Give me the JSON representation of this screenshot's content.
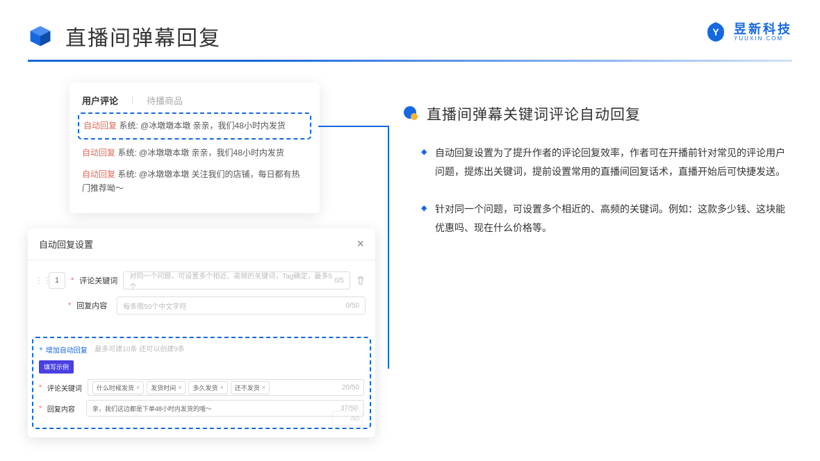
{
  "header": {
    "title": "直播间弹幕回复"
  },
  "logo": {
    "name": "昱新科技",
    "domain": "YUUXIN.COM"
  },
  "panel1": {
    "tab_active": "用户评论",
    "tab_inactive": "待播商品",
    "c1_label": "自动回复",
    "c1_sys": "系统: ",
    "c1_text": "@冰墩墩本墩 亲亲，我们48小时内发货",
    "c2_label": "自动回复",
    "c2_sys": "系统: ",
    "c2_text": "@冰墩墩本墩 亲亲，我们48小时内发货",
    "c3_label": "自动回复",
    "c3_sys": "系统: ",
    "c3_text": "@冰墩墩本墩 关注我们的店铺，每日都有热门推荐呦～"
  },
  "panel2": {
    "title": "自动回复设置",
    "index": "1",
    "keyword_label": "评论关键词",
    "keyword_placeholder": "对同一个问题，可设置多个相近、高频的关键词，Tag确定，最多5个",
    "keyword_count": "0/5",
    "content_label": "回复内容",
    "content_placeholder": "每条限50个中文字符",
    "content_count": "0/50",
    "add_label": "增加自动回复",
    "add_hint": "最多可建10条 还可以创建9条",
    "example_badge": "填写示例",
    "ex_kw_label": "评论关键词",
    "ex_tags": [
      "什么时候发货",
      "发货时间",
      "多久发货",
      "还不发货"
    ],
    "ex_kw_count": "20/50",
    "ex_content_label": "回复内容",
    "ex_content_text": "亲，我们这边都是下单48小时内发货的哦～",
    "ex_content_count": "37/50",
    "ghost_count": "/50"
  },
  "section": {
    "title": "直播间弹幕关键词评论自动回复",
    "p1": "自动回复设置为了提升作者的评论回复效率，作者可在开播前针对常见的评论用户问题，提炼出关键词，提前设置常用的直播间回复话术，直播开始后可快捷发送。",
    "p2": "针对同一个问题，可设置多个相近的、高频的关键词。例如：这款多少钱、这块能优惠吗、现在什么价格等。"
  }
}
